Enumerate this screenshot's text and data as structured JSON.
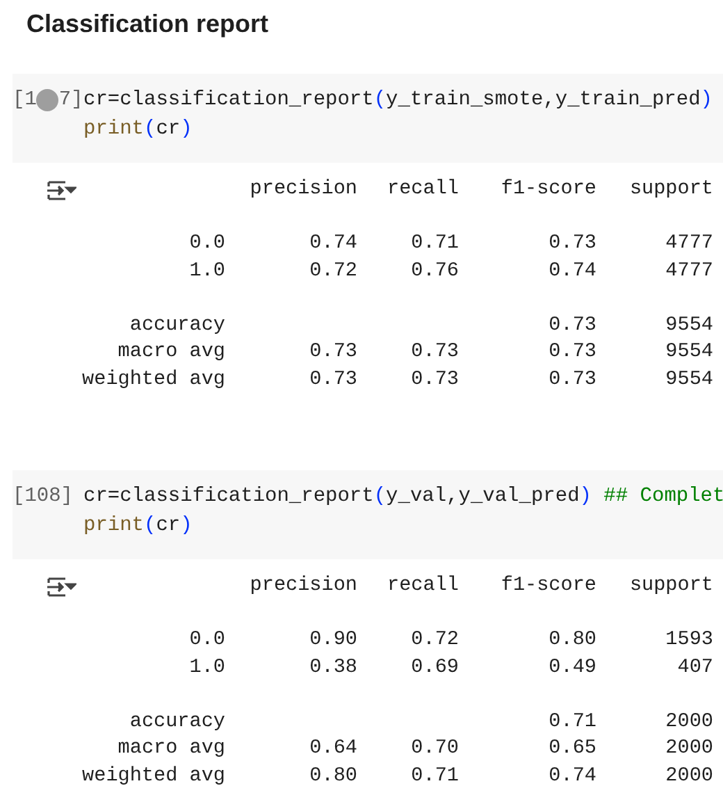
{
  "title": "Classification report",
  "cells": [
    {
      "label_start": "[1",
      "label_end": "7]",
      "run_button": true,
      "code": [
        [
          {
            "kind": "plain",
            "text": "cr=classification_report"
          },
          {
            "kind": "paren",
            "text": "("
          },
          {
            "kind": "plain",
            "text": "y_train_smote,y_train_pred"
          },
          {
            "kind": "paren",
            "text": ")"
          }
        ],
        [
          {
            "kind": "builtin",
            "text": "print"
          },
          {
            "kind": "paren",
            "text": "("
          },
          {
            "kind": "plain",
            "text": "cr"
          },
          {
            "kind": "paren",
            "text": ")"
          }
        ]
      ],
      "output": {
        "header": [
          "precision",
          "recall",
          "f1-score",
          "support"
        ],
        "groups": [
          {
            "rows": [
              {
                "label": "0.0",
                "precision": "0.74",
                "recall": "0.71",
                "f1_score": "0.73",
                "support": "4777"
              },
              {
                "label": "1.0",
                "precision": "0.72",
                "recall": "0.76",
                "f1_score": "0.74",
                "support": "4777"
              }
            ]
          },
          {
            "rows": [
              {
                "label": "accuracy",
                "f1_score": "0.73",
                "support": "9554"
              },
              {
                "label": "macro avg",
                "precision": "0.73",
                "recall": "0.73",
                "f1_score": "0.73",
                "support": "9554"
              },
              {
                "label": "weighted avg",
                "precision": "0.73",
                "recall": "0.73",
                "f1_score": "0.73",
                "support": "9554"
              }
            ]
          }
        ]
      }
    },
    {
      "label_start": "[108]",
      "code": [
        [
          {
            "kind": "plain",
            "text": "cr=classification_report"
          },
          {
            "kind": "paren",
            "text": "("
          },
          {
            "kind": "plain",
            "text": "y_val,y_val_pred"
          },
          {
            "kind": "paren",
            "text": ")"
          },
          {
            "kind": "comment",
            "text": " ## Complet"
          }
        ],
        [
          {
            "kind": "builtin",
            "text": "print"
          },
          {
            "kind": "paren",
            "text": "("
          },
          {
            "kind": "plain",
            "text": "cr"
          },
          {
            "kind": "paren",
            "text": ")"
          }
        ]
      ],
      "output": {
        "header": [
          "precision",
          "recall",
          "f1-score",
          "support"
        ],
        "groups": [
          {
            "rows": [
              {
                "label": "0.0",
                "precision": "0.90",
                "recall": "0.72",
                "f1_score": "0.80",
                "support": "1593"
              },
              {
                "label": "1.0",
                "precision": "0.38",
                "recall": "0.69",
                "f1_score": "0.49",
                "support": "407"
              }
            ]
          },
          {
            "rows": [
              {
                "label": "accuracy",
                "f1_score": "0.71",
                "support": "2000"
              },
              {
                "label": "macro avg",
                "precision": "0.64",
                "recall": "0.70",
                "f1_score": "0.65",
                "support": "2000"
              },
              {
                "label": "weighted avg",
                "precision": "0.80",
                "recall": "0.71",
                "f1_score": "0.74",
                "support": "2000"
              }
            ]
          }
        ]
      }
    }
  ]
}
